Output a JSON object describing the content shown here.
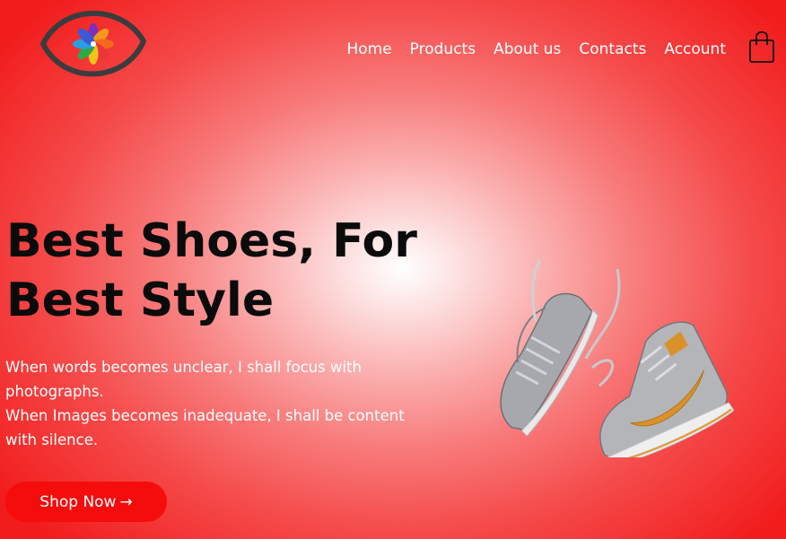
{
  "nav": {
    "items": [
      {
        "label": "Home"
      },
      {
        "label": "Products"
      },
      {
        "label": "About us"
      },
      {
        "label": "Contacts"
      },
      {
        "label": "Account"
      }
    ]
  },
  "hero": {
    "title_line1": "Best Shoes, For",
    "title_line2": "Best Style",
    "text_line1": "When words becomes unclear, I shall focus with photographs.",
    "text_line2": "When Images becomes inadequate, I shall be content with silence.",
    "button_label": "Shop Now",
    "button_arrow": "→"
  },
  "icons": {
    "logo": "eye-flower-logo",
    "cart": "shopping-bag-icon",
    "hero_image": "sneakers-pair"
  },
  "colors": {
    "accent": "#f50c0c",
    "gradient_center": "#ffffff",
    "gradient_edge": "#f21c1c",
    "title_text": "#0b0b0b",
    "nav_text": "#ffffff"
  }
}
